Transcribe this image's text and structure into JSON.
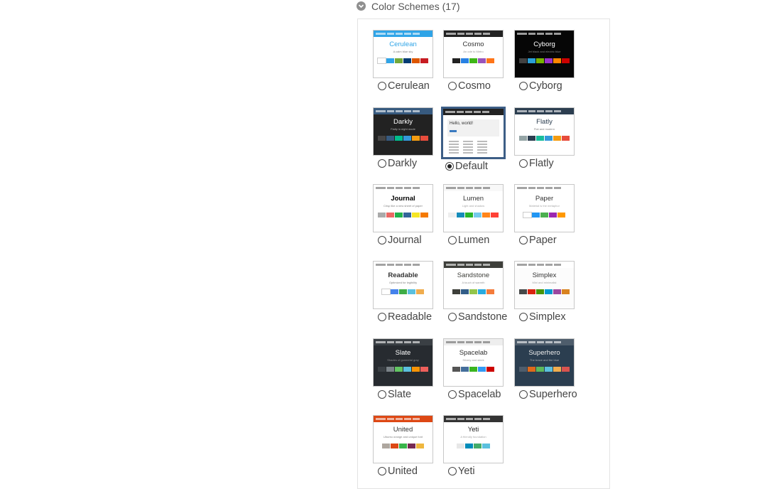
{
  "section": {
    "title": "Color Schemes (17)"
  },
  "schemes": [
    {
      "name": "Cerulean",
      "title": "Cerulean",
      "subtitle": "A calm blue sky",
      "selected": false,
      "bg": "#ffffff",
      "nav": "#2fa4e7",
      "title_color": "#2fa4e7",
      "text": "#555555",
      "buttons": [
        "#ffffff",
        "#2fa4e7",
        "#73a839",
        "#033c73",
        "#dd5600",
        "#c71c22"
      ]
    },
    {
      "name": "Cosmo",
      "title": "Cosmo",
      "subtitle": "An ode to Metro",
      "selected": false,
      "bg": "#ffffff",
      "nav": "#222222",
      "title_color": "#333333",
      "text": "#777777",
      "buttons": [
        "#222222",
        "#2780e3",
        "#3fb618",
        "#9954bb",
        "#ff7518"
      ]
    },
    {
      "name": "Cyborg",
      "title": "Cyborg",
      "subtitle": "Jet black and electric blue",
      "selected": false,
      "bg": "#060606",
      "nav": "#060606",
      "title_color": "#ffffff",
      "text": "#aaaaaa",
      "buttons": [
        "#424242",
        "#2a9fd6",
        "#77b300",
        "#9933cc",
        "#ff8800",
        "#cc0000"
      ]
    },
    {
      "name": "Darkly",
      "title": "Darkly",
      "subtitle": "Flatly in night mode",
      "selected": false,
      "bg": "#222222",
      "nav": "#375a7f",
      "title_color": "#ffffff",
      "text": "#dddddd",
      "buttons": [
        "#464545",
        "#375a7f",
        "#00bc8c",
        "#3498db",
        "#f39c12",
        "#e74c3c"
      ]
    },
    {
      "name": "Default",
      "title": "Hello, world!",
      "subtitle": "",
      "selected": true,
      "bg": "#ffffff",
      "nav": "#222222",
      "title_color": "#333333",
      "text": "#777777",
      "buttons": []
    },
    {
      "name": "Flatly",
      "title": "Flatly",
      "subtitle": "Flat and modern",
      "selected": false,
      "bg": "#ffffff",
      "nav": "#2c3e50",
      "title_color": "#2c3e50",
      "text": "#555555",
      "buttons": [
        "#95a5a6",
        "#2c3e50",
        "#18bc9c",
        "#3498db",
        "#f39c12",
        "#e74c3c"
      ]
    },
    {
      "name": "Journal",
      "title": "Journal",
      "subtitle": "Crisp like a new sheet of paper",
      "selected": false,
      "bg": "#ffffff",
      "nav": "#ffffff",
      "title_color": "#000000",
      "text": "#555555",
      "buttons": [
        "#aaaaaa",
        "#eb6864",
        "#22b24c",
        "#336699",
        "#f5e625",
        "#f57a00"
      ]
    },
    {
      "name": "Lumen",
      "title": "Lumen",
      "subtitle": "Light and shadow",
      "selected": false,
      "bg": "#ffffff",
      "nav": "#f8f8f8",
      "title_color": "#333333",
      "text": "#888888",
      "buttons": [
        "#eeeeee",
        "#158cba",
        "#28b62c",
        "#75caeb",
        "#ff851b",
        "#ff4136"
      ]
    },
    {
      "name": "Paper",
      "title": "Paper",
      "subtitle": "Material is the metaphor",
      "selected": false,
      "bg": "#ffffff",
      "nav": "#ffffff",
      "title_color": "#333333",
      "text": "#888888",
      "buttons": [
        "#ffffff",
        "#2196f3",
        "#4caf50",
        "#9c27b0",
        "#ff9800"
      ]
    },
    {
      "name": "Readable",
      "title": "Readable",
      "subtitle": "Optimized for legibility",
      "selected": false,
      "bg": "#ffffff",
      "nav": "#ffffff",
      "title_color": "#333333",
      "text": "#555555",
      "buttons": [
        "#ffffff",
        "#4582ec",
        "#3fad46",
        "#5bc0de",
        "#f0ad4e"
      ]
    },
    {
      "name": "Sandstone",
      "title": "Sandstone",
      "subtitle": "A touch of warmth",
      "selected": false,
      "bg": "#ffffff",
      "nav": "#3e3f3a",
      "title_color": "#3e3f3a",
      "text": "#777777",
      "buttons": [
        "#3e3f3a",
        "#325d88",
        "#93c54b",
        "#29abe0",
        "#f47c3c"
      ]
    },
    {
      "name": "Simplex",
      "title": "Simplex",
      "subtitle": "Mini and minimalist",
      "selected": false,
      "bg": "#fcfcfc",
      "nav": "#ffffff",
      "title_color": "#333333",
      "text": "#888888",
      "buttons": [
        "#474949",
        "#d9230f",
        "#469408",
        "#029acf",
        "#9b479f",
        "#d9831f"
      ]
    },
    {
      "name": "Slate",
      "title": "Slate",
      "subtitle": "Shades of gunmetal gray",
      "selected": false,
      "bg": "#272b30",
      "nav": "#3a3f44",
      "title_color": "#ffffff",
      "text": "#aaaaaa",
      "buttons": [
        "#3a3f44",
        "#7a8288",
        "#62c462",
        "#5bc0de",
        "#f89406",
        "#ee5f5b"
      ]
    },
    {
      "name": "Spacelab",
      "title": "Spacelab",
      "subtitle": "Silvery and sleek",
      "selected": false,
      "bg": "#ffffff",
      "nav": "#eeeeee",
      "title_color": "#2d2d2d",
      "text": "#777777",
      "buttons": [
        "#555555",
        "#446e9b",
        "#3cb521",
        "#3399f3",
        "#cd0200"
      ]
    },
    {
      "name": "Superhero",
      "title": "Superhero",
      "subtitle": "The brave and the blue",
      "selected": false,
      "bg": "#2b3e50",
      "nav": "#4e5d6c",
      "title_color": "#ebebeb",
      "text": "#cccccc",
      "buttons": [
        "#4e5d6c",
        "#df691a",
        "#5cb85c",
        "#5bc0de",
        "#f0ad4e",
        "#d9534f"
      ]
    },
    {
      "name": "United",
      "title": "United",
      "subtitle": "Ubuntu orange and unique font",
      "selected": false,
      "bg": "#ffffff",
      "nav": "#dd4814",
      "title_color": "#333333",
      "text": "#555555",
      "buttons": [
        "#aea79f",
        "#dd4814",
        "#38b44a",
        "#772953",
        "#efb73e"
      ]
    },
    {
      "name": "Yeti",
      "title": "Yeti",
      "subtitle": "A friendly foundation",
      "selected": false,
      "bg": "#ffffff",
      "nav": "#333333",
      "title_color": "#222222",
      "text": "#888888",
      "buttons": [
        "#e7e7e7",
        "#008cba",
        "#43ac6a",
        "#5bc0de"
      ]
    }
  ]
}
